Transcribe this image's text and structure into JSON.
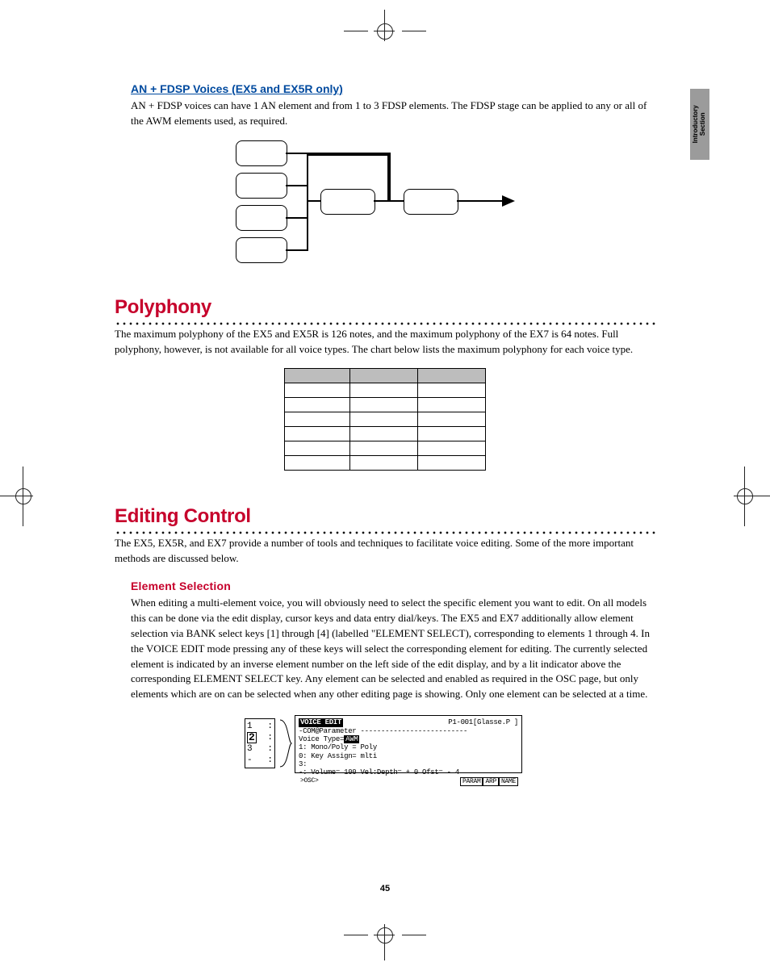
{
  "side_tab": "Introductory\nSection",
  "section1": {
    "subhead": "AN + FDSP Voices (EX5 and EX5R only)",
    "body": "AN + FDSP voices can have 1 AN element and from 1 to 3 FDSP elements. The FDSP stage can be applied to any or all of the AWM elements used, as required."
  },
  "section2": {
    "title": "Polyphony",
    "body": "The maximum polyphony of the EX5 and EX5R is 126 notes, and the maximum polyphony of the EX7 is 64 notes. Full polyphony, however, is not available for all voice types. The chart below lists the maximum polyphony for each voice type."
  },
  "section3": {
    "title": "Editing Control",
    "body": "The EX5, EX5R, and EX7 provide a number of tools and techniques to facilitate voice editing. Some of the more important methods are discussed below."
  },
  "section4": {
    "subhead": "Element Selection",
    "body": "When editing a multi-element voice, you will obviously need to select the specific element you want to edit. On all models this can be done via the edit display, cursor keys and data entry dial/keys. The EX5 and EX7 additionally allow element selection via BANK select keys [1] through [4] (labelled \"ELEMENT SELECT), corresponding to elements 1 through 4. In the VOICE EDIT mode pressing any of these keys will select the corresponding element for editing. The currently selected element is indicated by an inverse element number on the left side of the edit display, and by a lit indicator above the corresponding ELEMENT SELECT key. Any element can be selected and enabled as required in the OSC page, but only elements which are on can be selected when any other editing page is showing. Only one element can be selected at a time."
  },
  "selector": {
    "rows": [
      "1",
      "2",
      "3",
      "-"
    ],
    "active_index": 1
  },
  "lcd": {
    "title_left": "VOICE EDIT",
    "title_right": "P1-001[Glasse.P    ]",
    "line1": "-COM@Parameter --------------------------",
    "line2_label": "   Voice Type=",
    "line2_value": "AWM",
    "line3": "1: Mono/Poly = Poly",
    "line4": "0: Key Assign= mlti",
    "line5": "3:",
    "line6": "-: Volume= 100 Vel:Depth= + 0 Ofst= - 4",
    "tab_left": ">OSC>",
    "tabs": [
      "PARAM",
      "ARP",
      "NAME"
    ]
  },
  "page_number": "45"
}
